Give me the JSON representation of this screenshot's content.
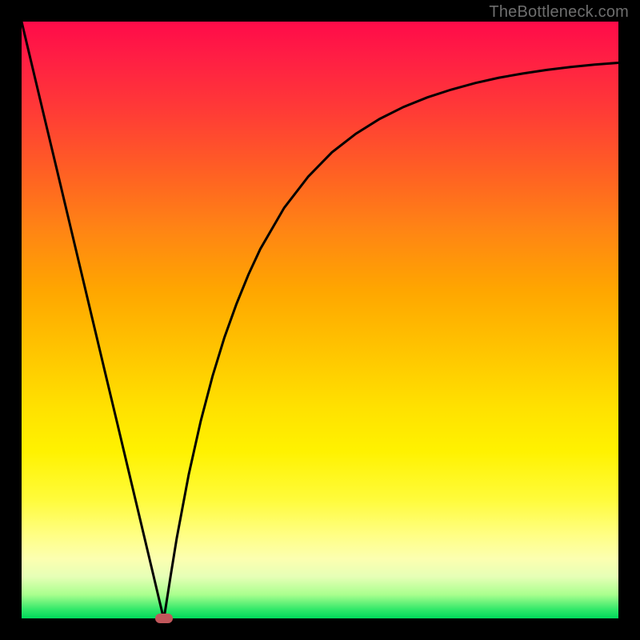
{
  "watermark": "TheBottleneck.com",
  "colors": {
    "frame": "#000000",
    "curve": "#000000",
    "marker": "#c1575b",
    "gradient_top": "#ff0b49",
    "gradient_bottom": "#00d85a"
  },
  "chart_data": {
    "type": "line",
    "title": "",
    "xlabel": "",
    "ylabel": "",
    "xlim": [
      0,
      100
    ],
    "ylim": [
      0,
      100
    ],
    "series": [
      {
        "name": "bottleneck-curve",
        "x": [
          0,
          2,
          4,
          6,
          8,
          10,
          12,
          14,
          16,
          18,
          20,
          22,
          23.8,
          24,
          25,
          26,
          28,
          30,
          32,
          34,
          36,
          38,
          40,
          44,
          48,
          52,
          56,
          60,
          64,
          68,
          72,
          76,
          80,
          84,
          88,
          92,
          96,
          100
        ],
        "y": [
          100,
          91.6,
          83.2,
          74.8,
          66.4,
          58.0,
          49.6,
          41.2,
          32.8,
          24.4,
          16.0,
          7.6,
          0.0,
          0.9,
          7.3,
          13.5,
          24.1,
          33.0,
          40.6,
          47.1,
          52.7,
          57.6,
          61.9,
          68.8,
          74.0,
          78.1,
          81.2,
          83.7,
          85.7,
          87.3,
          88.6,
          89.7,
          90.6,
          91.3,
          91.9,
          92.4,
          92.8,
          93.1
        ]
      }
    ],
    "annotations": [
      {
        "name": "optimum-marker",
        "x": 23.8,
        "y": 0.0
      }
    ],
    "grid": false,
    "legend": false
  }
}
